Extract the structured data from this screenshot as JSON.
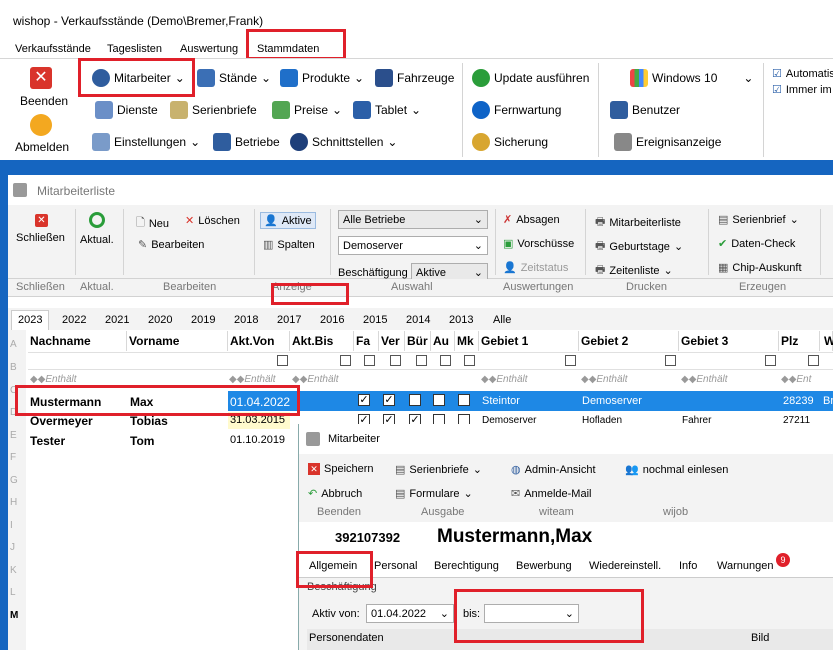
{
  "main_window": {
    "title": "wishop - Verkaufsstände (Demo\\Bremer,Frank)",
    "tabs": [
      "Verkaufsstände",
      "Tageslisten",
      "Auswertung",
      "Stammdaten"
    ],
    "ribbon": {
      "beenden": "Beenden",
      "abmelden": "Abmelden",
      "mitarbeiter": "Mitarbeiter",
      "staende": "Stände",
      "produkte": "Produkte",
      "fahrzeuge": "Fahrzeuge",
      "dienste": "Dienste",
      "serienbriefe": "Serienbriefe",
      "preise": "Preise",
      "tablet": "Tablet",
      "einstellungen": "Einstellungen",
      "betriebe": "Betriebe",
      "schnittstellen": "Schnittstellen",
      "update": "Update ausführen",
      "fernwartung": "Fernwartung",
      "sicherung": "Sicherung",
      "windows": "Windows 10",
      "benutzer": "Benutzer",
      "ereignisanzeige": "Ereignisanzeige",
      "automatis": "Automatis",
      "immer": "Immer im Vi"
    }
  },
  "list_window": {
    "title": "Mitarbeiterliste",
    "ribbon": {
      "schliessen": "Schließen",
      "aktual": "Aktual.",
      "neu": "Neu",
      "loeschen": "Löschen",
      "bearbeiten": "Bearbeiten",
      "aktive": "Aktive",
      "spalten": "Spalten",
      "betrieb_select": "Alle Betriebe",
      "server_select": "Demoserver",
      "beschaeftigung_label": "Beschäftigung",
      "beschaeftigung_select": "Aktive",
      "absagen": "Absagen",
      "vorschuesse": "Vorschüsse",
      "zeitstatus": "Zeitstatus",
      "mitarbeiterliste": "Mitarbeiterliste",
      "geburtstage": "Geburtstage",
      "zeitenliste": "Zeitenliste",
      "serienbrief": "Serienbrief",
      "daten_check": "Daten-Check",
      "chip": "Chip-Auskunft"
    },
    "groups": [
      "Schließen",
      "Aktual.",
      "Bearbeiten",
      "Anzeige",
      "Auswahl",
      "Auswertungen",
      "Drucken",
      "Erzeugen"
    ],
    "years": [
      "2023",
      "2022",
      "2021",
      "2020",
      "2019",
      "2018",
      "2017",
      "2016",
      "2015",
      "2014",
      "2013",
      "Alle"
    ],
    "columns": [
      "Nachname",
      "Vorname",
      "Akt.Von",
      "Akt.Bis",
      "Fa",
      "Ver",
      "Bür",
      "Au",
      "Mk",
      "Gebiet 1",
      "Gebiet 2",
      "Gebiet 3",
      "Plz",
      "W"
    ],
    "contains": "Enthält",
    "contains_short": "Ent",
    "rows": [
      {
        "nachname": "Mustermann",
        "vorname": "Max",
        "von": "01.04.2022",
        "gebiet1": "Steintor",
        "gebiet2": "Demoserver",
        "plz": "28239",
        "w": "Br"
      },
      {
        "nachname": "Overmeyer",
        "vorname": "Tobias",
        "von": "31.03.2015",
        "gebiet1": "Demoserver",
        "gebiet2": "Hofladen",
        "gebiet3": "Fahrer",
        "plz": "27211"
      },
      {
        "nachname": "Tester",
        "vorname": "Tom",
        "von": "01.10.2019"
      }
    ],
    "letters": [
      "A",
      "B",
      "C",
      "D",
      "E",
      "F",
      "G",
      "H",
      "I",
      "J",
      "K",
      "L",
      "M"
    ]
  },
  "popup": {
    "title": "Mitarbeiter",
    "speichern": "Speichern",
    "abbruch": "Abbruch",
    "serienbriefe": "Serienbriefe",
    "formulare": "Formulare",
    "admin": "Admin-Ansicht",
    "anmelde": "Anmelde-Mail",
    "einlesen": "nochmal einlesen",
    "groups": [
      "Beenden",
      "Ausgabe",
      "witeam",
      "wijob"
    ],
    "id": "392107392",
    "name": "Mustermann,Max",
    "tabs": [
      "Allgemein",
      "Personal",
      "Berechtigung",
      "Bewerbung",
      "Wiedereinstell.",
      "Info",
      "Warnungen"
    ],
    "warn_count": "9",
    "beschaeftigung": "Beschäftigung",
    "aktiv_von_label": "Aktiv von:",
    "aktiv_von": "01.04.2022",
    "bis_label": "bis:",
    "personendaten": "Personendaten",
    "bild": "Bild"
  },
  "colors": {
    "accent": "#0a66c2",
    "highlight": "#1e88e5",
    "red": "#e0202a"
  }
}
